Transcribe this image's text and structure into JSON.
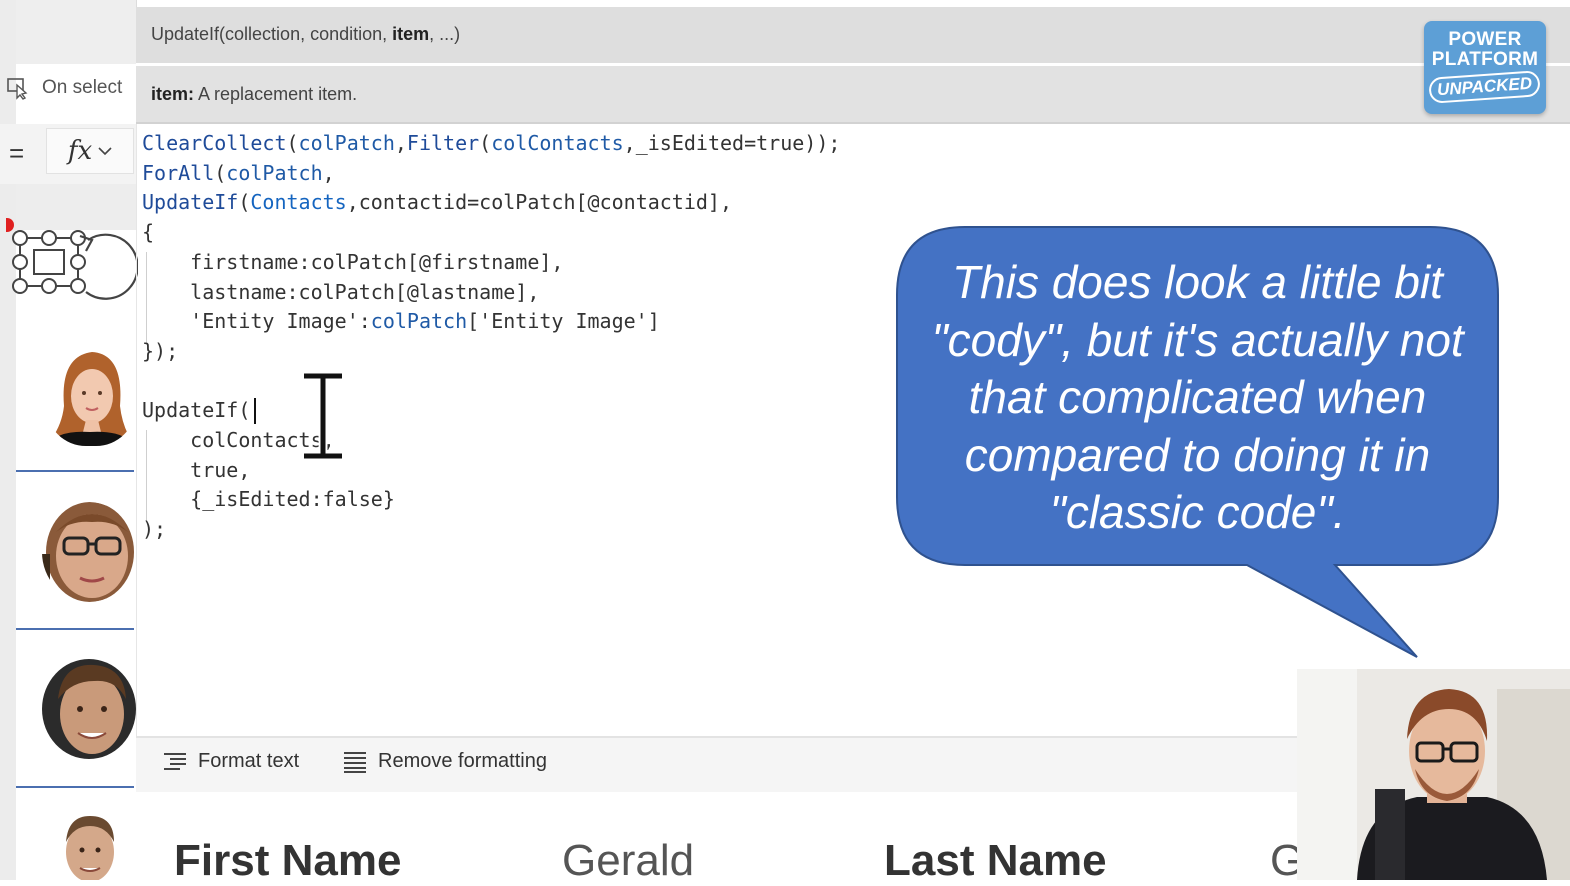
{
  "formula_bar": {
    "property": "On select",
    "equals": "=",
    "fx_label": "fx",
    "signature": {
      "prefix": "UpdateIf(collection, condition, ",
      "bold": "item",
      "suffix": ", ...)"
    },
    "parameter_help": {
      "name": "item:",
      "description": " A replacement item."
    }
  },
  "logo": {
    "line1": "POWER",
    "line2": "PLATFORM",
    "line3": "UNPACKED"
  },
  "code": {
    "l1": [
      "ClearCollect",
      "(",
      "colPatch",
      ",",
      "Filter",
      "(",
      "colContacts",
      ",_isEdited=true));"
    ],
    "l2": [
      "ForAll",
      "(",
      "colPatch",
      ","
    ],
    "l3": [
      "UpdateIf",
      "(",
      "Contacts",
      ",contactid=colPatch[@contactid],"
    ],
    "l4": "{",
    "l5": "    firstname:colPatch[@firstname],",
    "l6": "    lastname:colPatch[@lastname],",
    "l7": [
      "    'Entity Image':",
      "colPatch",
      "['Entity Image']"
    ],
    "l8": "});",
    "l9": "",
    "l10": "UpdateIf(",
    "l11": "    colContacts,",
    "l12": "    true,",
    "l13": "    {_isEdited:false}",
    "l14": ");"
  },
  "callout": {
    "text": "This does look a little bit \"cody\", but it's actually not that complicated when compared to doing it in \"classic code\"."
  },
  "toolbar": {
    "format_text": "Format text",
    "remove_formatting": "Remove formatting"
  },
  "form": {
    "first_name_label": "First Name",
    "first_name_value": "Gerald",
    "last_name_label": "Last Name",
    "last_name_value": "G"
  },
  "colors": {
    "callout_fill": "#4472c4",
    "keyword_blue": "#1f4b99",
    "logo_blue": "#5d9fd6"
  }
}
